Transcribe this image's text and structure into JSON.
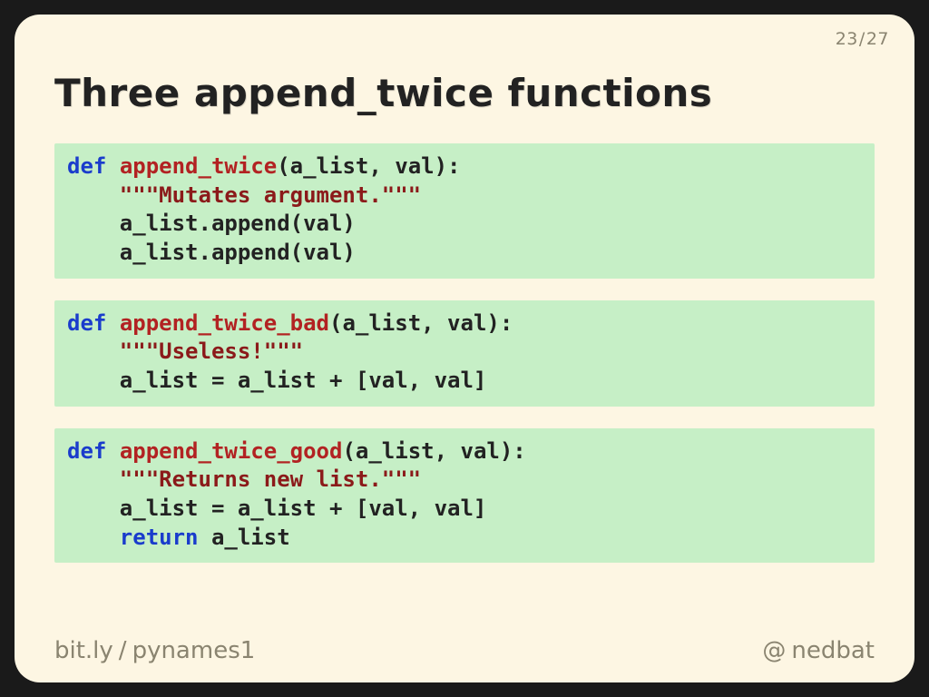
{
  "page": {
    "current": "23",
    "total": "27",
    "sep": "/"
  },
  "title": "Three append_twice functions",
  "code": {
    "b1": {
      "def": "def",
      "name": "append_twice",
      "sig": "(a_list, val):",
      "doc": "\"\"\"Mutates argument.\"\"\"",
      "l1": "a_list.append(val)",
      "l2": "a_list.append(val)"
    },
    "b2": {
      "def": "def",
      "name": "append_twice_bad",
      "sig": "(a_list, val):",
      "doc": "\"\"\"Useless!\"\"\"",
      "l1": "a_list = a_list + [val, val]"
    },
    "b3": {
      "def": "def",
      "name": "append_twice_good",
      "sig": "(a_list, val):",
      "doc": "\"\"\"Returns new list.\"\"\"",
      "l1": "a_list = a_list + [val, val]",
      "ret": "return",
      "l2": " a_list"
    }
  },
  "footer": {
    "left_a": "bit.ly",
    "left_sep": "/",
    "left_b": "pynames1",
    "at": "@",
    "handle": "nedbat"
  }
}
